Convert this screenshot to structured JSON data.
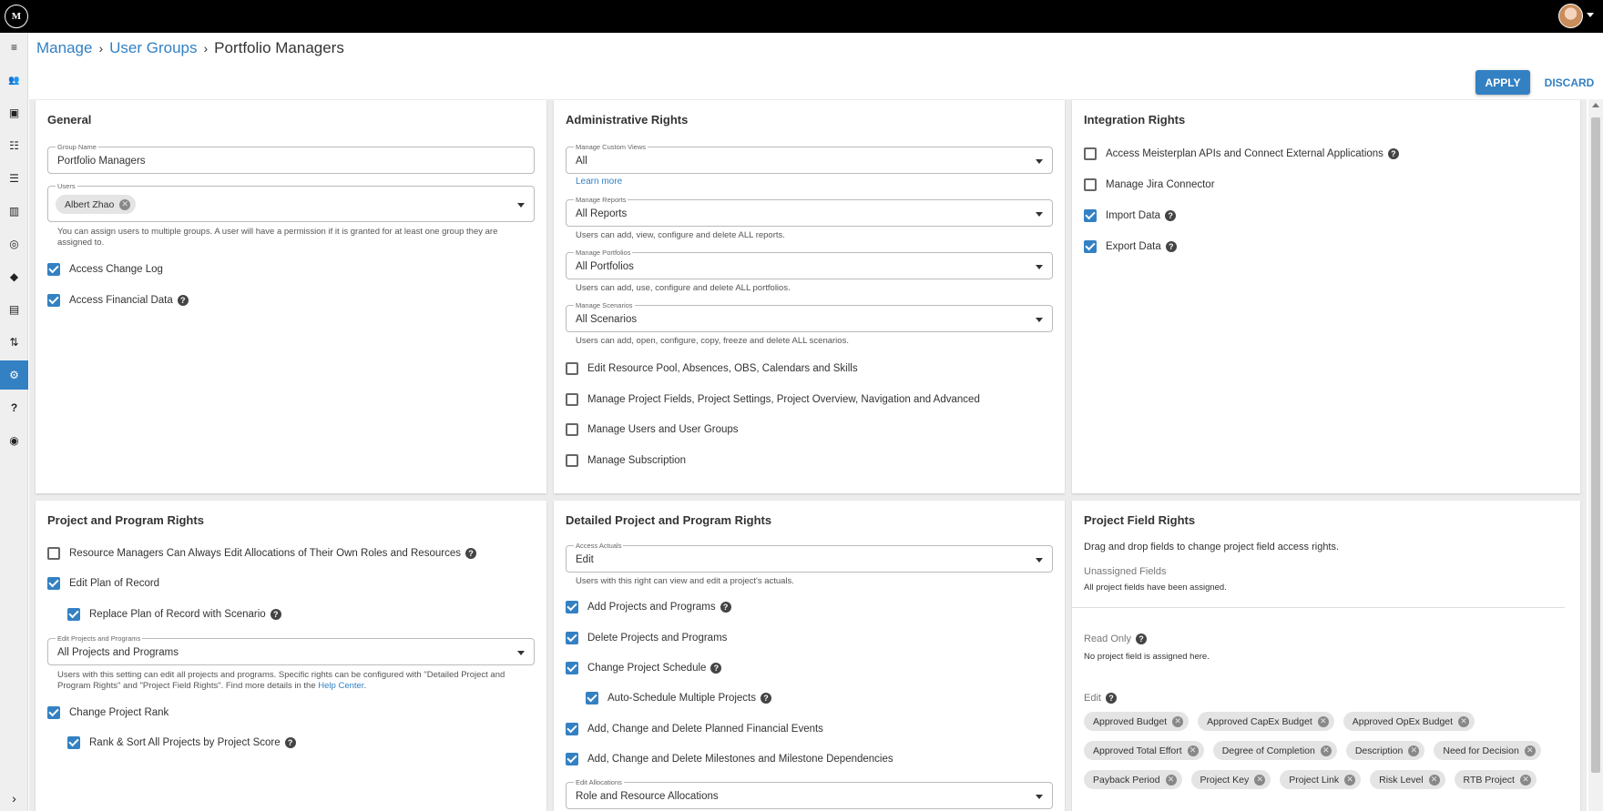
{
  "header": {
    "logo_text": "M"
  },
  "nav": {
    "items": [
      {
        "icon": "menu-icon",
        "glyph": "≡"
      },
      {
        "icon": "users-icon",
        "glyph": "👥"
      },
      {
        "icon": "badge-icon",
        "glyph": "▣"
      },
      {
        "icon": "team-icon",
        "glyph": "☷"
      },
      {
        "icon": "list-icon",
        "glyph": "☰"
      },
      {
        "icon": "columns-icon",
        "glyph": "▥"
      },
      {
        "icon": "target-icon",
        "glyph": "◎"
      },
      {
        "icon": "diamond-icon",
        "glyph": "◆"
      },
      {
        "icon": "document-icon",
        "glyph": "▤"
      },
      {
        "icon": "sort-icon",
        "glyph": "⇅"
      },
      {
        "icon": "gear-icon",
        "glyph": "⚙"
      },
      {
        "icon": "help-icon",
        "glyph": "?"
      },
      {
        "icon": "compass-icon",
        "glyph": "◉"
      }
    ],
    "expand_glyph": "›"
  },
  "breadcrumb": {
    "items": [
      "Manage",
      "User Groups"
    ],
    "current": "Portfolio Managers",
    "separator": "›"
  },
  "actions": {
    "apply": "APPLY",
    "discard": "DISCARD"
  },
  "general": {
    "title": "General",
    "group_name_label": "Group Name",
    "group_name_value": "Portfolio Managers",
    "users_label": "Users",
    "user_chip": "Albert Zhao",
    "users_helper": "You can assign users to multiple groups. A user will have a permission if it is granted for at least one group they are assigned to.",
    "access_change_log": "Access Change Log",
    "access_financial_data": "Access Financial Data"
  },
  "admin": {
    "title": "Administrative Rights",
    "custom_views_label": "Manage Custom Views",
    "custom_views_value": "All",
    "learn_more": "Learn more",
    "reports_label": "Manage Reports",
    "reports_value": "All Reports",
    "reports_helper": "Users can add, view, configure and delete ALL reports.",
    "portfolios_label": "Manage Portfolios",
    "portfolios_value": "All Portfolios",
    "portfolios_helper": "Users can add, use, configure and delete ALL portfolios.",
    "scenarios_label": "Manage Scenarios",
    "scenarios_value": "All Scenarios",
    "scenarios_helper": "Users can add, open, configure, copy, freeze and delete ALL scenarios.",
    "edit_resource_pool": "Edit Resource Pool, Absences, OBS, Calendars and Skills",
    "manage_project_fields": "Manage Project Fields, Project Settings, Project Overview, Navigation and Advanced",
    "manage_users": "Manage Users and User Groups",
    "manage_subscription": "Manage Subscription"
  },
  "integration": {
    "title": "Integration Rights",
    "access_apis": "Access Meisterplan APIs and Connect External Applications",
    "manage_jira": "Manage Jira Connector",
    "import_data": "Import Data",
    "export_data": "Export Data"
  },
  "project_program": {
    "title": "Project and Program Rights",
    "resource_managers": "Resource Managers Can Always Edit Allocations of Their Own Roles and Resources",
    "edit_plan": "Edit Plan of Record",
    "replace_plan": "Replace Plan of Record with Scenario",
    "edit_projects_label": "Edit Projects and Programs",
    "edit_projects_value": "All Projects and Programs",
    "edit_projects_helper_1": "Users with this setting can edit all projects and programs. Specific rights can be configured with \"Detailed Project and Program Rights\" and \"Project Field Rights\". Find more details in the",
    "help_center": "Help Center",
    "change_rank": "Change Project Rank",
    "rank_sort": "Rank & Sort All Projects by Project Score"
  },
  "detailed": {
    "title": "Detailed Project and Program Rights",
    "access_actuals_label": "Access Actuals",
    "access_actuals_value": "Edit",
    "access_actuals_helper": "Users with this right can view and edit a project's actuals.",
    "add_projects": "Add Projects and Programs",
    "delete_projects": "Delete Projects and Programs",
    "change_schedule": "Change Project Schedule",
    "auto_schedule": "Auto-Schedule Multiple Projects",
    "financial_events": "Add, Change and Delete Planned Financial Events",
    "milestones": "Add, Change and Delete Milestones and Milestone Dependencies",
    "edit_allocations_label": "Edit Allocations",
    "edit_allocations_value": "Role and Resource Allocations"
  },
  "field_rights": {
    "title": "Project Field Rights",
    "description": "Drag and drop fields to change project field access rights.",
    "unassigned_heading": "Unassigned Fields",
    "unassigned_text": "All project fields have been assigned.",
    "read_only_heading": "Read Only",
    "read_only_text": "No project field is assigned here.",
    "edit_heading": "Edit",
    "edit_chips_row1": [
      "Approved Budget",
      "Approved CapEx Budget",
      "Approved OpEx Budget"
    ],
    "edit_chips_row2": [
      "Approved Total Effort",
      "Degree of Completion",
      "Description",
      "Need for Decision"
    ],
    "edit_chips_row3": [
      "Payback Period",
      "Project Key",
      "Project Link",
      "Risk Level",
      "RTB Project"
    ]
  },
  "help_glyph": "?",
  "remove_glyph": "✕",
  "colors": {
    "accent": "#3381c3",
    "topbar": "#000000"
  }
}
